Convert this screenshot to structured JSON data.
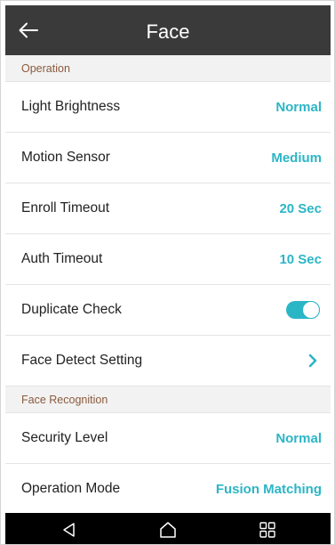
{
  "header": {
    "title": "Face",
    "back_icon": "arrow-left-icon"
  },
  "sections": [
    {
      "title": "Operation"
    },
    {
      "title": "Face Recognition"
    }
  ],
  "rows": {
    "light_brightness": {
      "label": "Light Brightness",
      "value": "Normal"
    },
    "motion_sensor": {
      "label": "Motion Sensor",
      "value": "Medium"
    },
    "enroll_timeout": {
      "label": "Enroll Timeout",
      "value": "20 Sec"
    },
    "auth_timeout": {
      "label": "Auth Timeout",
      "value": "10 Sec"
    },
    "duplicate_check": {
      "label": "Duplicate Check",
      "toggle_on": true
    },
    "face_detect_setting": {
      "label": "Face Detect Setting",
      "icon": "chevron-right-icon"
    },
    "security_level": {
      "label": "Security Level",
      "value": "Normal"
    },
    "operation_mode": {
      "label": "Operation Mode",
      "value": "Fusion Matching"
    }
  },
  "navbar": {
    "icons": [
      "back-triangle-icon",
      "home-icon",
      "recent-apps-icon"
    ]
  },
  "colors": {
    "header_bg": "#3a3a3a",
    "accent": "#2bb6c6",
    "section_text": "#8a5a3c",
    "section_bg": "#f2f2f2",
    "navbar_bg": "#000000"
  }
}
